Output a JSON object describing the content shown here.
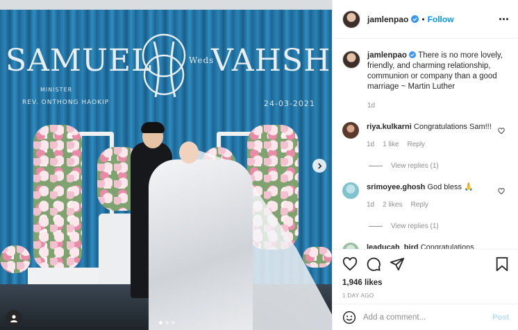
{
  "photo": {
    "name_left": "SAMUEL",
    "name_right": "VAHSHI",
    "monogram_joiner": "Weds",
    "minister_title": "MINISTER",
    "minister_name": "REV. ONTHONG HAOKIP",
    "event_date": "24-03-2021",
    "carousel": {
      "count": 3,
      "active_index": 0
    }
  },
  "post": {
    "author": "jamlenpao",
    "follow_label": "Follow",
    "caption": "There is no more lovely, friendly, and charming relationship, communion or company than a good marriage ~ Martin Luther",
    "caption_age": "1d",
    "comments": [
      {
        "user": "riya.kulkarni",
        "text": "Congratulations Sam!!!",
        "age": "1d",
        "likes": "1 like",
        "reply_label": "Reply",
        "view_replies": "View replies (1)"
      },
      {
        "user": "srimoyee.ghosh",
        "text": "God bless 🙏",
        "age": "1d",
        "likes": "2 likes",
        "reply_label": "Reply",
        "view_replies": "View replies (1)"
      },
      {
        "user": "leaducah_bird",
        "text": "Congratulations"
      }
    ],
    "likes": "1,946 likes",
    "date": "1 DAY AGO",
    "add_comment_placeholder": "Add a comment...",
    "post_label": "Post"
  },
  "colors": {
    "accent": "#0095f6",
    "muted": "#8e8e8e",
    "post_disabled": "#b2dffc"
  }
}
